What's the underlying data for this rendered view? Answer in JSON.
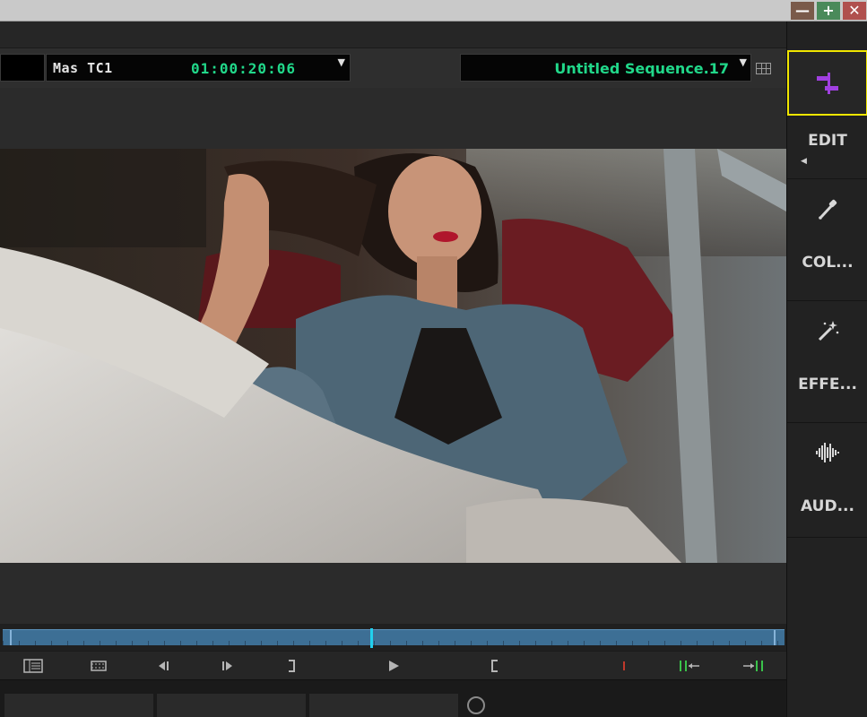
{
  "window": {
    "minimize_label": "—",
    "maximize_label": "+",
    "close_label": "✕"
  },
  "monitor": {
    "tc_label": "Mas  TC1",
    "tc_value": "01:00:20:06",
    "sequence_name": "Untitled Sequence.17"
  },
  "transport": {
    "buttons": [
      {
        "name": "timeline-view-icon"
      },
      {
        "name": "filmstrip-icon"
      },
      {
        "name": "step-back-icon"
      },
      {
        "name": "step-forward-icon"
      },
      {
        "name": "mark-out-icon"
      },
      {
        "name": "play-icon"
      },
      {
        "name": "mark-in-icon"
      },
      {
        "name": "audio-level-icon"
      },
      {
        "name": "go-to-in-icon"
      },
      {
        "name": "go-to-out-icon"
      }
    ]
  },
  "workspace": {
    "items": [
      {
        "label": "EDIT",
        "icon": "edit-icon",
        "active": true
      },
      {
        "label": "COL...",
        "icon": "eyedropper-icon"
      },
      {
        "label": "EFFE...",
        "icon": "magic-wand-icon"
      },
      {
        "label": "AUD...",
        "icon": "waveform-icon"
      }
    ]
  },
  "colors": {
    "timecode": "#21d88a",
    "active_outline": "#f0e600",
    "edit_icon": "#a040e0",
    "playhead": "#21d0ee",
    "scrub_bar": "#3d6f95"
  }
}
